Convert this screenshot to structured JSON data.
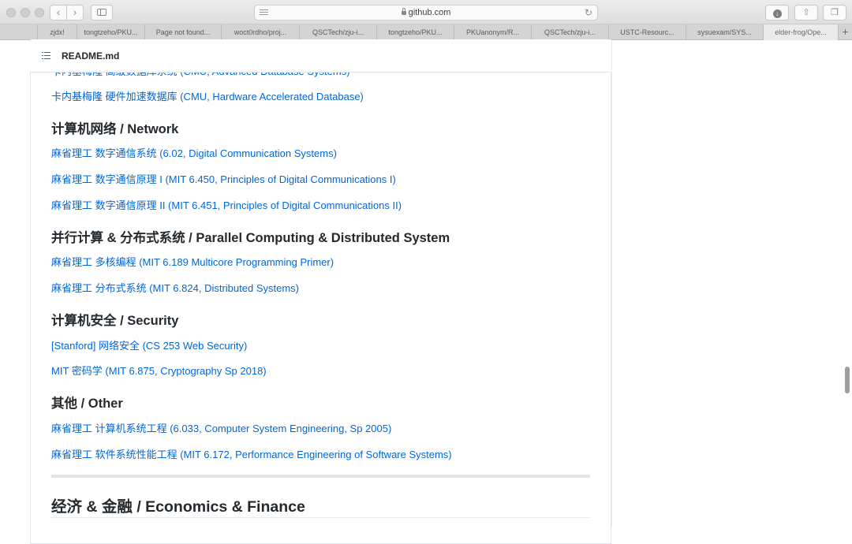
{
  "browser": {
    "url": "github.com",
    "tabs": [
      {
        "label": "zjdx!",
        "active": false
      },
      {
        "label": "tongtzeho/PKU...",
        "active": false
      },
      {
        "label": "Page not found...",
        "active": false
      },
      {
        "label": "woct0rdho/proj...",
        "active": false
      },
      {
        "label": "QSCTech/zju-i...",
        "active": false
      },
      {
        "label": "tongtzeho/PKU...",
        "active": false
      },
      {
        "label": "PKUanonym/R...",
        "active": false
      },
      {
        "label": "QSCTech/zju-i...",
        "active": false
      },
      {
        "label": "USTC-Resourc...",
        "active": false
      },
      {
        "label": "sysuexam/SYS...",
        "active": false
      },
      {
        "label": "elder-frog/Ope...",
        "active": true
      }
    ],
    "new_tab_label": "+"
  },
  "readme": {
    "title": "README.md"
  },
  "content": {
    "clipped_link": "卡内基梅隆 高级数据库系统 (CMU, Advanced Database Systems)",
    "db_link": "卡内基梅隆 硬件加速数据库 (CMU, Hardware Accelerated Database)",
    "network": {
      "heading": "计算机网络 / Network",
      "links": [
        "麻省理工 数字通信系统 (6.02, Digital Communication Systems)",
        "麻省理工 数字通信原理 I (MIT 6.450, Principles of Digital Communications I)",
        "麻省理工 数字通信原理 II (MIT 6.451, Principles of Digital Communications II)"
      ]
    },
    "parallel": {
      "heading": "并行计算 & 分布式系统 / Parallel Computing & Distributed System",
      "links": [
        "麻省理工 多核编程 (MIT 6.189 Multicore Programming Primer)",
        "麻省理工 分布式系统 (MIT 6.824, Distributed Systems)"
      ]
    },
    "security": {
      "heading": "计算机安全 / Security",
      "links": [
        "[Stanford] 网络安全 (CS 253 Web Security)",
        "MIT 密码学 (MIT 6.875, Cryptography Sp 2018)"
      ]
    },
    "other": {
      "heading": "其他 / Other",
      "links": [
        "麻省理工 计算机系统工程 (6.033, Computer System Engineering, Sp 2005)",
        "麻省理工 软件系统性能工程 (MIT 6.172, Performance Engineering of Software Systems)"
      ]
    },
    "economics_heading": "经济 & 金融 / Economics & Finance"
  },
  "colors": {
    "link": "#0366d6",
    "heading": "#24292e",
    "border": "#e1e4e8"
  }
}
